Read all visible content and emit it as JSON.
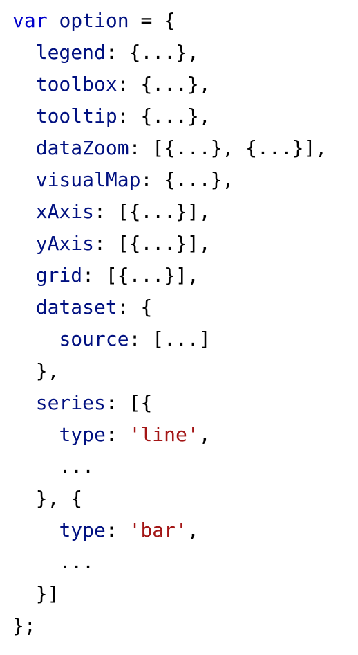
{
  "code": {
    "line01": {
      "kw": "var",
      "name": "option",
      "punc": " = {"
    },
    "line02": {
      "indent": "  ",
      "key": "legend",
      "punc": ": {...},"
    },
    "line03": {
      "indent": "  ",
      "key": "toolbox",
      "punc": ": {...},"
    },
    "line04": {
      "indent": "  ",
      "key": "tooltip",
      "punc": ": {...},"
    },
    "line05": {
      "indent": "  ",
      "key": "dataZoom",
      "punc": ": [{...}, {...}],"
    },
    "line06": {
      "indent": "  ",
      "key": "visualMap",
      "punc": ": {...},"
    },
    "line07": {
      "indent": "  ",
      "key": "xAxis",
      "punc": ": [{...}],"
    },
    "line08": {
      "indent": "  ",
      "key": "yAxis",
      "punc": ": [{...}],"
    },
    "line09": {
      "indent": "  ",
      "key": "grid",
      "punc": ": [{...}],"
    },
    "line10": {
      "indent": "  ",
      "key": "dataset",
      "punc": ": {"
    },
    "line11": {
      "indent": "    ",
      "key": "source",
      "punc": ": [...]"
    },
    "line12": {
      "indent": "  ",
      "punc": "},"
    },
    "line13": {
      "indent": "  ",
      "key": "series",
      "punc": ": [{"
    },
    "line14": {
      "indent": "    ",
      "key": "type",
      "punc_before": ": ",
      "str": "'line'",
      "punc_after": ","
    },
    "line15": {
      "indent": "    ",
      "punc": "..."
    },
    "line16": {
      "indent": "  ",
      "punc": "}, {"
    },
    "line17": {
      "indent": "    ",
      "key": "type",
      "punc_before": ": ",
      "str": "'bar'",
      "punc_after": ","
    },
    "line18": {
      "indent": "    ",
      "punc": "..."
    },
    "line19": {
      "indent": "  ",
      "punc": "}]"
    },
    "line20": {
      "punc": "};"
    }
  },
  "colors": {
    "keyword": "#0000cc",
    "identifier": "#001080",
    "string": "#a31515",
    "punctuation": "#000000",
    "background": "#ffffff"
  }
}
